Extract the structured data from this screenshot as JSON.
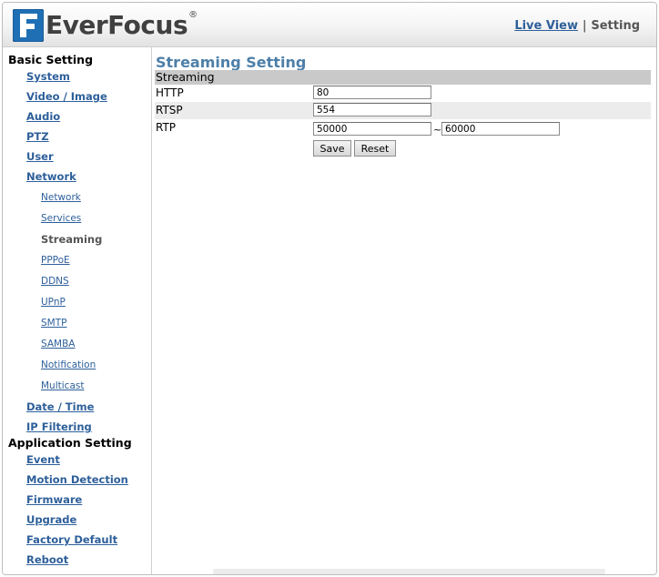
{
  "brand": {
    "name": "EverFocus",
    "reg": "®"
  },
  "top_nav": {
    "live_view": "Live View",
    "separator": "|",
    "setting": "Setting"
  },
  "sidebar": {
    "basic_heading": "Basic Setting",
    "basic_items": [
      "System",
      "Video / Image",
      "Audio",
      "PTZ",
      "User",
      "Network"
    ],
    "network_items": [
      "Network",
      "Services",
      "Streaming",
      "PPPoE",
      "DDNS",
      "UPnP",
      "SMTP",
      "SAMBA",
      "Notification",
      "Multicast"
    ],
    "active_sub": "Streaming",
    "basic_items_after": [
      "Date / Time",
      "IP Filtering"
    ],
    "app_heading": "Application Setting",
    "app_items": [
      "Event",
      "Motion Detection",
      "Firmware",
      "Upgrade",
      "Factory Default",
      "Reboot"
    ]
  },
  "main": {
    "title": "Streaming Setting",
    "section": "Streaming",
    "http": {
      "label": "HTTP",
      "value": "80"
    },
    "rtsp": {
      "label": "RTSP",
      "value": "554"
    },
    "rtp": {
      "label": "RTP",
      "from": "50000",
      "sep": "~",
      "to": "60000"
    },
    "save_label": "Save",
    "reset_label": "Reset"
  },
  "colors": {
    "link": "#2d5f9a",
    "title": "#4d7fa8",
    "section_bar": "#c9c9c9",
    "alt_row": "#ececec"
  }
}
